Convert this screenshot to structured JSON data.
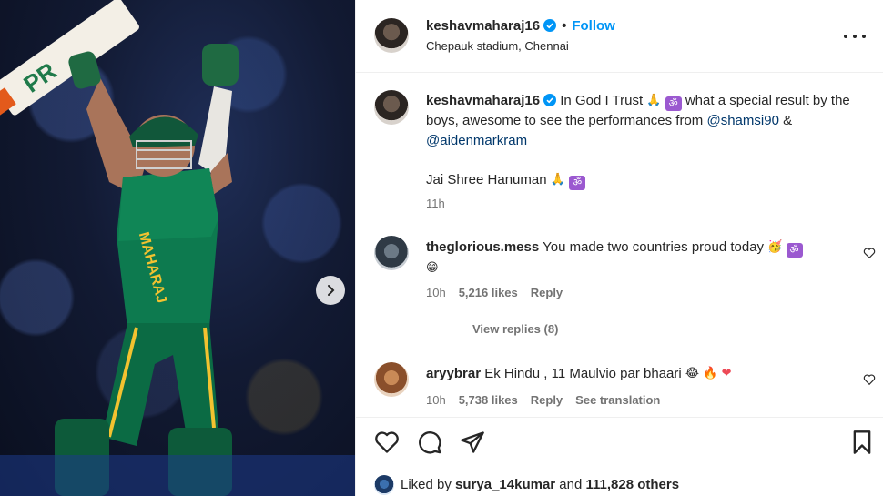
{
  "post": {
    "username": "keshavmaharaj16",
    "follow_label": "Follow",
    "location": "Chepauk stadium, Chennai",
    "more_icon": "more-horizontal-icon"
  },
  "caption": {
    "username": "keshavmaharaj16",
    "text_1": "In God I Trust",
    "emoji_1": "🙏",
    "om_1": "ॐ",
    "text_2": "what a special result by the boys, awesome to see the performances from",
    "mention_1": "@shamsi90",
    "amp": "&",
    "mention_2": "@aidenmarkram",
    "line_2": "Jai Shree Hanuman",
    "emoji_2": "🙏",
    "om_2": "ॐ",
    "time": "11h"
  },
  "comments": [
    {
      "username": "theglorious.mess",
      "text": "You made two countries proud today",
      "emoji_a": "🥳",
      "om": "ॐ",
      "emoji_b": "😁",
      "time": "10h",
      "likes": "5,216 likes",
      "reply": "Reply",
      "view_replies": "View replies (8)"
    },
    {
      "username": "aryybrar",
      "text": "Ek Hindu , 11 Maulvio par bhaari",
      "emoji_a": "😂",
      "emoji_b": "🔥",
      "emoji_c": "❤",
      "time": "10h",
      "likes": "5,738 likes",
      "reply": "Reply",
      "translation": "See translation"
    }
  ],
  "footer": {
    "liked_by_prefix": "Liked by",
    "liked_by_user": "surya_14kumar",
    "and_label": "and",
    "others": "111,828 others"
  },
  "colors": {
    "accent": "#0095f6",
    "mention": "#00376b",
    "muted": "#737373",
    "kit_green": "#0d7a4f",
    "kit_yellow": "#f2c230"
  },
  "photo": {
    "bat_text": "PR"
  }
}
